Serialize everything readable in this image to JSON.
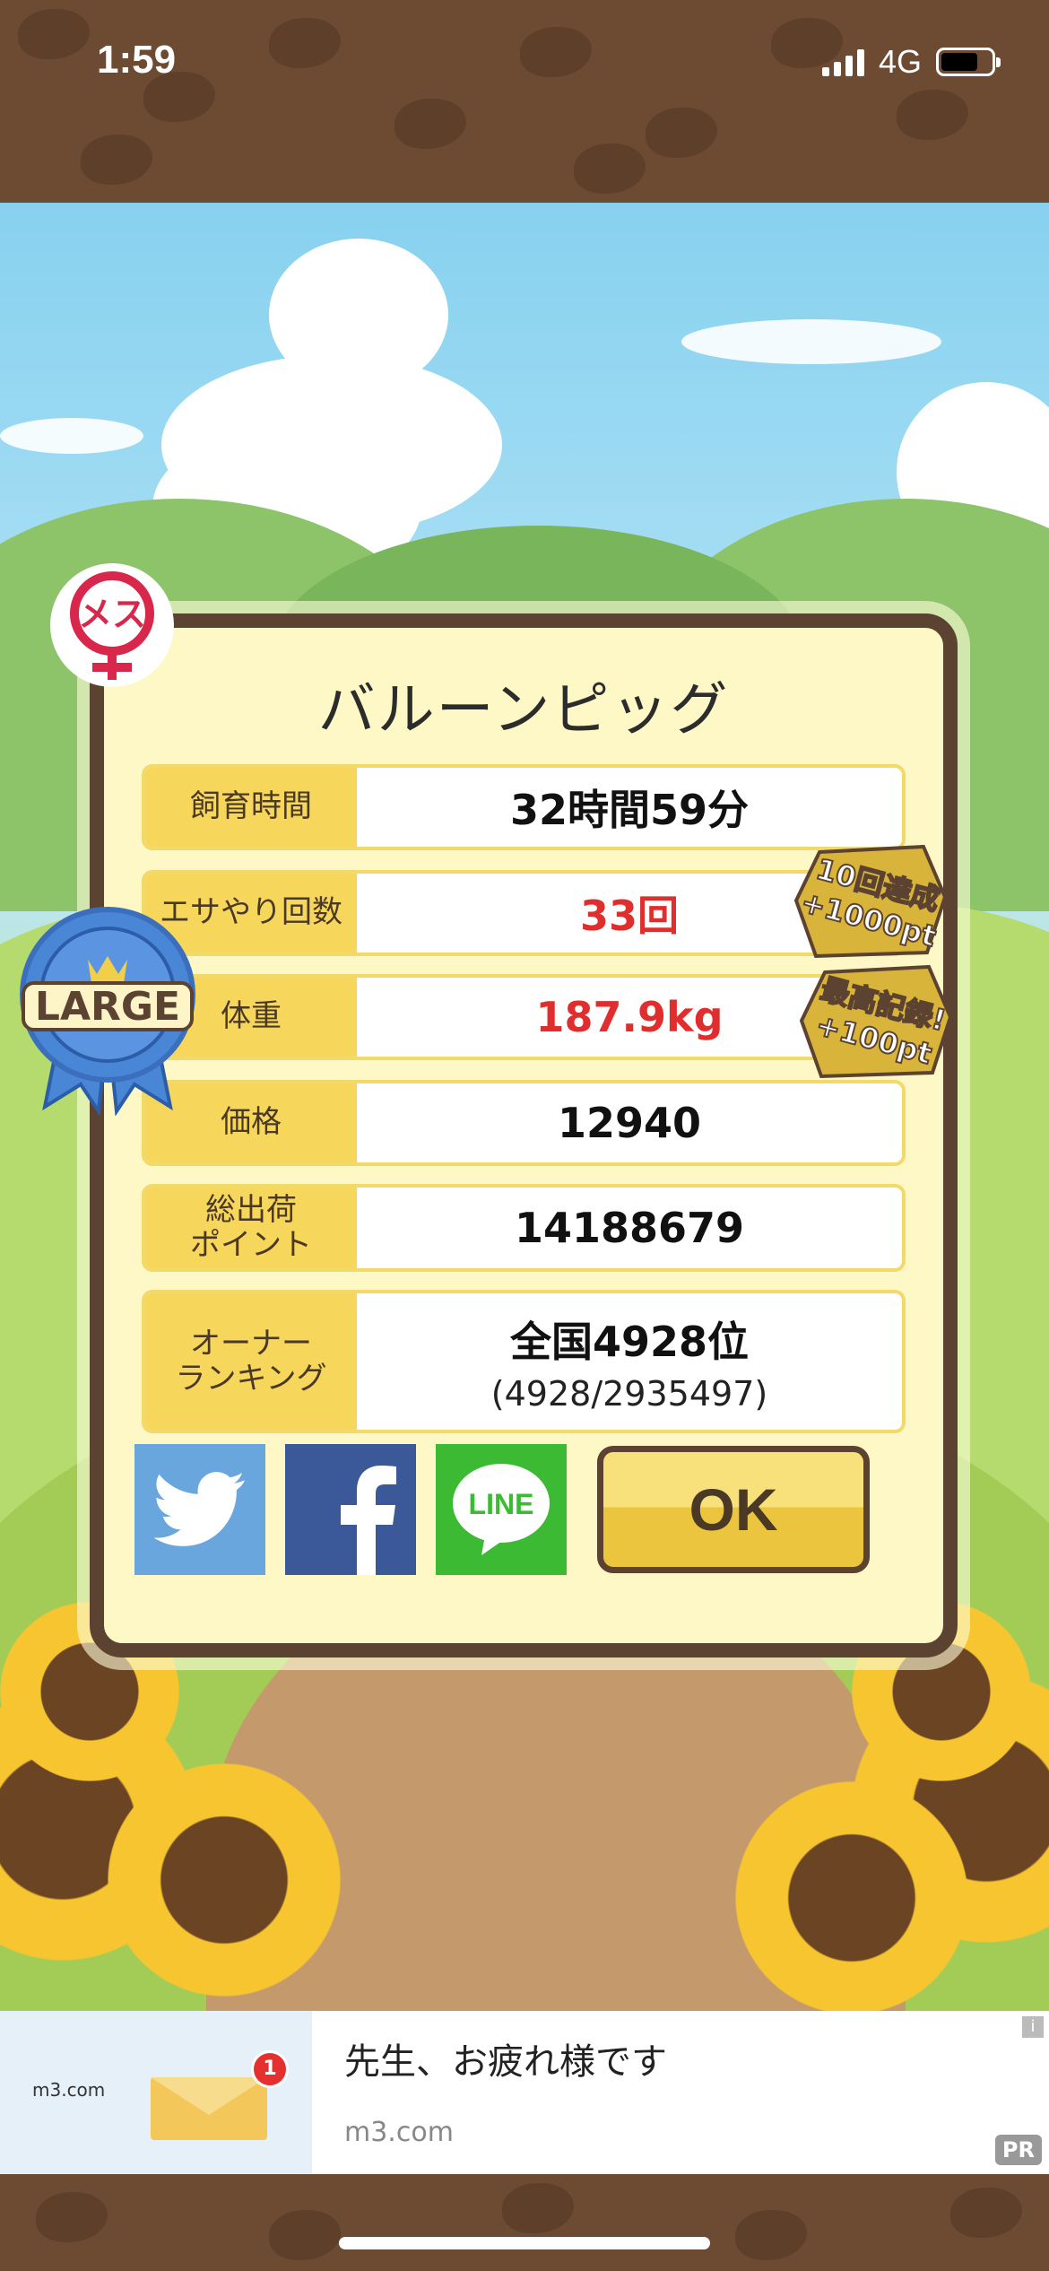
{
  "status_bar": {
    "time": "1:59",
    "network": "4G"
  },
  "gender_badge": {
    "text": "メス"
  },
  "size_ribbon": {
    "text": "LARGE"
  },
  "result_panel": {
    "title": "バルーンピッグ",
    "rows": [
      {
        "label": "飼育時間",
        "value": "32時間59分",
        "highlight": false
      },
      {
        "label": "エサやり回数",
        "value": "33回",
        "highlight": true
      },
      {
        "label": "体重",
        "value": "187.9kg",
        "highlight": true
      },
      {
        "label": "価格",
        "value": "12940",
        "highlight": false
      },
      {
        "label": "総出荷\nポイント",
        "value": "14188679",
        "highlight": false
      },
      {
        "label": "オーナー\nランキング",
        "value": "全国4928位",
        "sub": "(4928/2935497)",
        "highlight": false
      }
    ],
    "bonus_badges": [
      {
        "line1": "10回達成",
        "line2": "+1000pt"
      },
      {
        "line1": "最高記録!",
        "line2": "+100pt"
      }
    ],
    "share_buttons": [
      {
        "name": "twitter",
        "icon": "twitter-bird-icon",
        "color": "#6aa6de"
      },
      {
        "name": "facebook",
        "icon": "facebook-f-icon",
        "color": "#3b5998"
      },
      {
        "name": "line",
        "icon": "line-icon",
        "label": "LINE",
        "color": "#3dba34"
      }
    ],
    "ok_label": "OK"
  },
  "ad": {
    "logo": "m3.com",
    "headline": "先生、お疲れ様です",
    "domain": "m3.com",
    "pr_label": "PR",
    "info_icon": "i",
    "notification_count": "1"
  },
  "colors": {
    "panel_border": "#5c4331",
    "label_bg": "#f7d65c",
    "highlight_text": "#e02d2d",
    "panel_bg": "#fdf8c6"
  }
}
